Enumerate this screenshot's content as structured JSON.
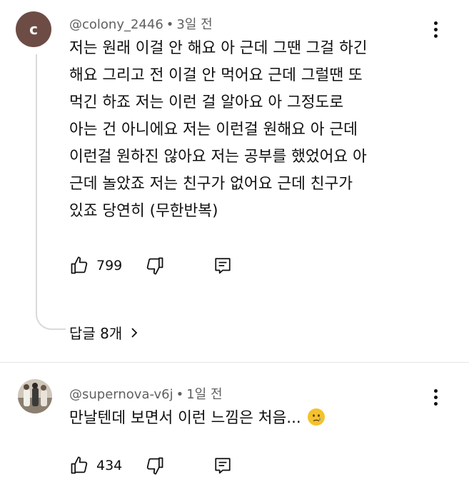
{
  "comments": [
    {
      "avatar_letter": "c",
      "author": "@colony_2446",
      "time": "3일 전",
      "lines": [
        "저는 원래 이걸 안 해요 아 근데 그땐 그걸 하긴",
        "해요 그리고 전 이걸 안 먹어요 근데 그럴땐 또",
        "먹긴 하죠 저는 이런 걸 알아요 아 그정도로",
        "아는 건 아니에요 저는 이런걸 원해요 아 근데",
        "이런걸 원하진 않아요 저는 공부를 했었어요 아",
        "근데 놀았죠 저는 친구가 없어요 근데 친구가",
        "있죠 당연히 (무한반복)"
      ],
      "likes": "799",
      "replies_label": "답글 8개"
    },
    {
      "author": "@supernova-v6j",
      "time": "1일 전",
      "text": "만날텐데 보면서 이런 느낌은 처음...",
      "emoji": "crying-face-emoji",
      "likes": "434"
    }
  ],
  "icons": {
    "like": "thumb-up-icon",
    "dislike": "thumb-down-icon",
    "reply": "reply-comment-icon",
    "more": "more-vertical-icon",
    "replies_chevron": "chevron-right-icon"
  },
  "colors": {
    "avatar_bg": "#6d4c45",
    "meta_text": "#606060",
    "text": "#0f0f0f",
    "thread_line": "#d9d9d9"
  }
}
